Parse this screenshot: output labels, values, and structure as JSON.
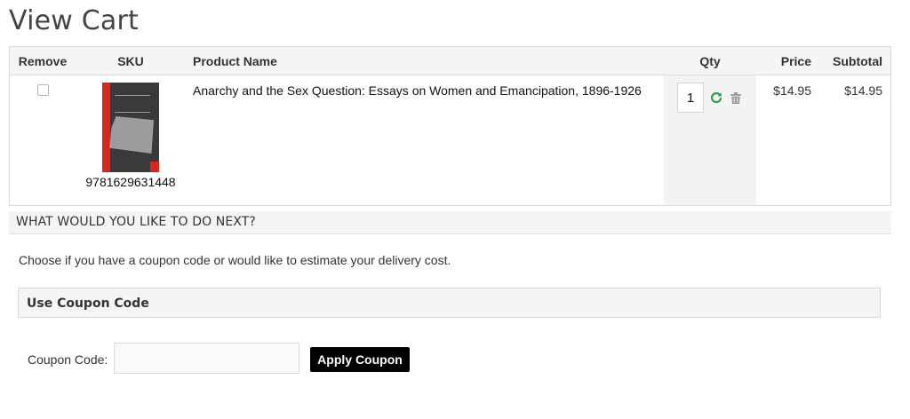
{
  "page": {
    "title": "View Cart"
  },
  "table": {
    "headers": {
      "remove": "Remove",
      "sku": "SKU",
      "product_name": "Product Name",
      "qty": "Qty",
      "price": "Price",
      "subtotal": "Subtotal"
    },
    "rows": [
      {
        "removed": false,
        "sku": "9781629631448",
        "product_name": "Anarchy and the Sex Question: Essays on Women and Emancipation, 1896-1926",
        "qty": "1",
        "price": "$14.95",
        "subtotal": "$14.95",
        "icons": {
          "update": "refresh-icon",
          "delete": "trash-icon"
        }
      }
    ]
  },
  "next_steps": {
    "heading": "WHAT WOULD YOU LIKE TO DO NEXT?",
    "description": "Choose if you have a coupon code or would like to estimate your delivery cost."
  },
  "coupon": {
    "panel_title": "Use Coupon Code",
    "label": "Coupon Code:",
    "value": "",
    "button_label": "Apply Coupon"
  },
  "colors": {
    "refresh_icon": "#2e9e4a",
    "trash_icon": "#9a9a9a",
    "button_bg": "#000000",
    "cover_red": "#d8261c"
  }
}
